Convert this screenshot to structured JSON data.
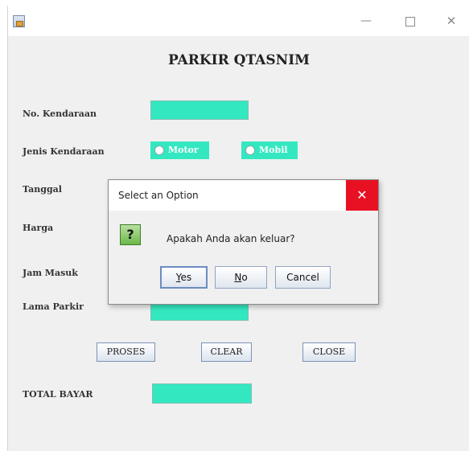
{
  "window": {
    "icon": "java-app-icon",
    "controls": {
      "minimize": "—",
      "maximize": "",
      "close": "✕"
    }
  },
  "form": {
    "title": "PARKIR QTASNIM",
    "labels": {
      "no_kendaraan": "No. Kendaraan",
      "jenis_kendaraan": "Jenis Kendaraan",
      "tanggal": "Tanggal",
      "harga": "Harga",
      "jam_masuk": "Jam Masuk",
      "lama_parkir": "Lama Parkir",
      "total_bayar": "TOTAL BAYAR"
    },
    "radio_options": [
      "Motor",
      "Mobil"
    ],
    "buttons": {
      "proses": "PROSES",
      "clear": "CLEAR",
      "close": "CLOSE"
    },
    "field_color": "#33e8c0"
  },
  "dialog": {
    "title": "Select an Option",
    "message": "Apakah Anda akan keluar?",
    "icon": "question-icon",
    "icon_glyph": "?",
    "close_glyph": "✕",
    "buttons": {
      "yes": {
        "mnemonic": "Y",
        "rest": "es"
      },
      "no": {
        "mnemonic": "N",
        "rest": "o"
      },
      "cancel": "Cancel"
    }
  }
}
